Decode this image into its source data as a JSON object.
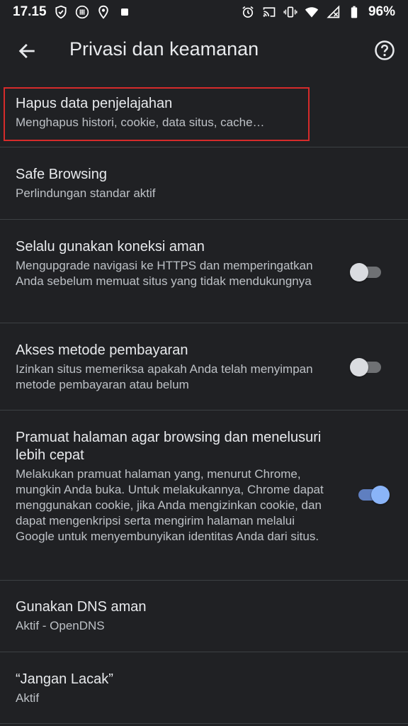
{
  "status": {
    "time": "17.15",
    "battery": "96%",
    "left_icons": [
      "shield-check-icon",
      "grid-dots-icon",
      "location-pin-icon",
      "stop-square-icon"
    ],
    "right_icons": [
      "alarm-icon",
      "cast-icon",
      "vibrate-icon",
      "wifi-icon",
      "signal-icon",
      "battery-icon"
    ]
  },
  "appbar": {
    "title": "Privasi dan keamanan",
    "back_icon": "arrow-back-icon",
    "help_icon": "help-circle-icon"
  },
  "settings": [
    {
      "title": "Hapus data penjelajahan",
      "subtitle": "Menghapus histori, cookie, data situs, cache…"
    },
    {
      "title": "Safe Browsing",
      "subtitle": "Perlindungan standar aktif"
    },
    {
      "title": "Selalu gunakan koneksi aman",
      "subtitle": "Mengupgrade navigasi ke HTTPS dan memperingatkan Anda sebelum memuat situs yang tidak mendukungnya",
      "toggle": false
    },
    {
      "title": "Akses metode pembayaran",
      "subtitle": "Izinkan situs memeriksa apakah Anda telah menyimpan metode pembayaran atau belum",
      "toggle": false
    },
    {
      "title": "Pramuat halaman agar browsing dan menelusuri lebih cepat",
      "subtitle": "Melakukan pramuat halaman yang, menurut Chrome, mungkin Anda buka. Untuk melakukannya, Chrome dapat menggunakan cookie, jika Anda mengizinkan cookie, dan dapat mengenkripsi serta mengirim halaman melalui Google untuk menyembunyikan identitas Anda dari situs.",
      "toggle": true
    },
    {
      "title": "Gunakan DNS aman",
      "subtitle": "Aktif - OpenDNS"
    },
    {
      "title": "“Jangan Lacak”",
      "subtitle": "Aktif"
    }
  ],
  "colors": {
    "background": "#202124",
    "highlight": "#d62b2b",
    "toggle_on": "#8ab4f8"
  }
}
